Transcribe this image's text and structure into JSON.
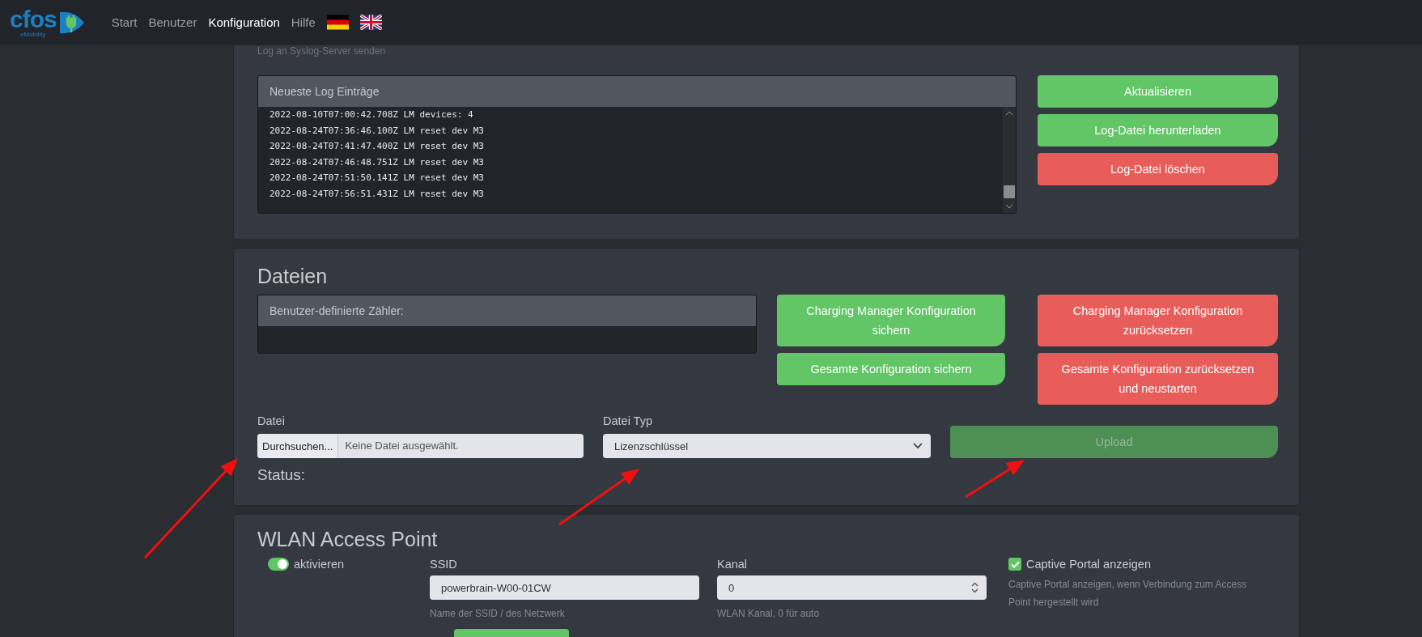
{
  "nav": {
    "logo": {
      "name": "cfos",
      "tagline": "eMobility"
    },
    "items": [
      {
        "label": "Start",
        "selected": false
      },
      {
        "label": "Benutzer",
        "selected": false
      },
      {
        "label": "Konfiguration",
        "selected": true
      },
      {
        "label": "Hilfe",
        "selected": false
      }
    ],
    "languages": [
      {
        "kind": "de"
      },
      {
        "kind": "en"
      }
    ]
  },
  "log_panel": {
    "hint": "Log an Syslog-Server senden",
    "title": "Neueste Log Einträge",
    "entries": [
      "2022-08-10T07:00:42.708Z LM devices: 4",
      "2022-08-24T07:36:46.100Z LM reset dev M3",
      "2022-08-24T07:41:47.400Z LM reset dev M3",
      "2022-08-24T07:46:48.751Z LM reset dev M3",
      "2022-08-24T07:51:50.141Z LM reset dev M3",
      "2022-08-24T07:56:51.431Z LM reset dev M3"
    ],
    "buttons": [
      {
        "label": "Aktualisieren",
        "kind": "confirm"
      },
      {
        "label": "Log-Datei herunterladen",
        "kind": "confirm"
      },
      {
        "label": "Log-Datei löschen",
        "kind": "delete"
      }
    ]
  },
  "files_panel": {
    "title": "Dateien",
    "counters_title": "Benutzer-definierte Zähler:",
    "save_buttons": [
      {
        "label": "Charging Manager Konfiguration sichern",
        "kind": "confirm"
      },
      {
        "label": "Gesamte Konfiguration sichern",
        "kind": "confirm"
      }
    ],
    "reset_buttons": [
      {
        "label": "Charging Manager Konfiguration zurücksetzen",
        "kind": "delete"
      },
      {
        "label": "Gesamte Konfiguration zurücksetzen und neustarten",
        "kind": "delete"
      }
    ],
    "file_label": "Datei",
    "browse_button": "Durchsuchen...",
    "file_value": "Keine Datei ausgewählt.",
    "type_label": "Datei Typ",
    "type_value": "Lizenzschlüssel",
    "upload": {
      "label": "Upload",
      "disabled": true
    },
    "status_label": "Status:"
  },
  "wlan_panel": {
    "title": "WLAN Access Point",
    "enable": {
      "label": "aktivieren",
      "on": true
    },
    "ssid": {
      "label": "SSID",
      "value": "powerbrain-W00-01CW",
      "help": "Name der SSID / des Netzwerk"
    },
    "channel": {
      "label": "Kanal",
      "value": "0",
      "help": "WLAN Kanal, 0 für auto"
    },
    "captive": {
      "label": "Captive Portal anzeigen",
      "checked": true,
      "help": "Captive Portal anzeigen, wenn Verbindung zum Access Point hergestellt wird"
    }
  }
}
